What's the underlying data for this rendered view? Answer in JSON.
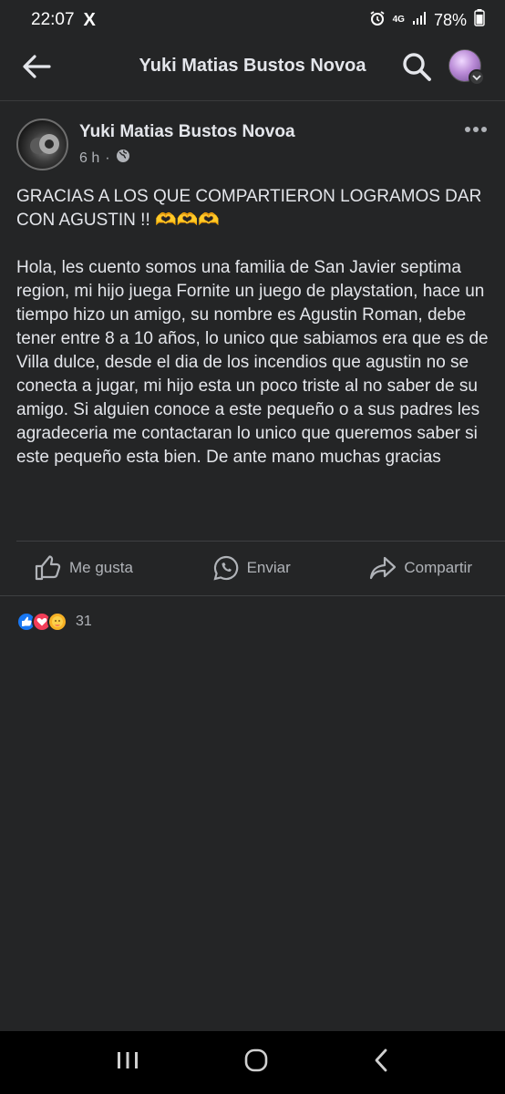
{
  "status_bar": {
    "time": "22:07",
    "x_icon": "X",
    "network": "4G",
    "battery": "78%"
  },
  "header": {
    "title": "Yuki Matias Bustos Novoa"
  },
  "post": {
    "author": "Yuki Matias Bustos Novoa",
    "time_ago": "6 h",
    "separator": "·",
    "text": "GRACIAS A LOS QUE COMPARTIERON LOGRAMOS DAR CON AGUSTIN !! 🫶🫶🫶\n\nHola, les cuento somos una familia de San Javier septima region, mi hijo juega Fornite un juego de playstation, hace un tiempo hizo un amigo, su nombre es Agustin Roman, debe tener entre 8 a 10 años, lo unico que sabiamos era que es de Villa dulce, desde el dia de los incendios que agustin no se conecta a jugar, mi hijo esta un poco triste al no saber de su amigo. Si alguien conoce a este pequeño o a sus padres les agradeceria me contactaran lo unico que queremos saber si este pequeño esta bien. De ante mano muchas gracias",
    "actions": {
      "like": "Me gusta",
      "send": "Enviar",
      "share": "Compartir"
    },
    "reactions": {
      "types": [
        "like",
        "love",
        "care"
      ],
      "count": "31"
    }
  },
  "colors": {
    "background": "#242526",
    "text": "#e4e6eb",
    "secondary_text": "#b0b3b8",
    "like_blue": "#1877f2",
    "love_red": "#f33e58",
    "care_yellow": "#f7b125"
  }
}
